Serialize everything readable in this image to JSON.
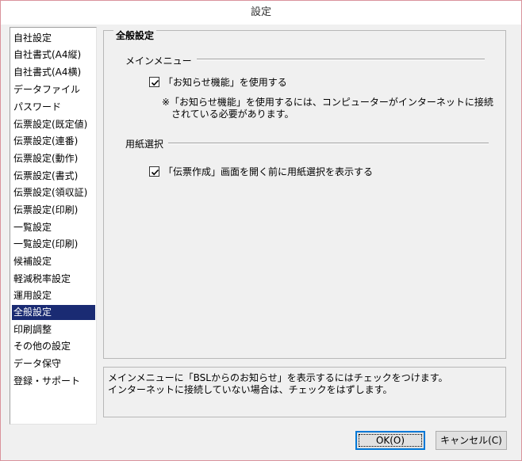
{
  "window": {
    "title": "設定"
  },
  "sidebar": {
    "items": [
      {
        "label": "自社設定"
      },
      {
        "label": "自社書式(A4縦)"
      },
      {
        "label": "自社書式(A4横)"
      },
      {
        "label": "データファイル"
      },
      {
        "label": "パスワード"
      },
      {
        "label": "伝票設定(既定値)"
      },
      {
        "label": "伝票設定(連番)"
      },
      {
        "label": "伝票設定(動作)"
      },
      {
        "label": "伝票設定(書式)"
      },
      {
        "label": "伝票設定(領収証)"
      },
      {
        "label": "伝票設定(印刷)"
      },
      {
        "label": "一覧設定"
      },
      {
        "label": "一覧設定(印刷)"
      },
      {
        "label": "候補設定"
      },
      {
        "label": "軽減税率設定"
      },
      {
        "label": "運用設定"
      },
      {
        "label": "全般設定"
      },
      {
        "label": "印刷調整"
      },
      {
        "label": "その他の設定"
      },
      {
        "label": "データ保守"
      },
      {
        "label": "登録・サポート"
      }
    ],
    "selected": "全般設定"
  },
  "main": {
    "title": "全般設定",
    "sections": [
      {
        "label": "メインメニュー",
        "checkbox": {
          "label": "「お知らせ機能」を使用する",
          "checked": true
        },
        "note_line1": "※「お知らせ機能」を使用するには、コンピューターがインターネットに接続",
        "note_line2": "されている必要があります。"
      },
      {
        "label": "用紙選択",
        "checkbox": {
          "label": "「伝票作成」画面を開く前に用紙選択を表示する",
          "checked": true
        }
      }
    ]
  },
  "help": {
    "line1": "メインメニューに「BSLからのお知らせ」を表示するにはチェックをつけます。",
    "line2": "インターネットに接続していない場合は、チェックをはずします。"
  },
  "buttons": {
    "ok": "OK(O)",
    "cancel": "キャンセル(C)"
  },
  "colors": {
    "selection": "#1a2b73",
    "default_button_border": "#0078d7",
    "window_border": "#d9939c"
  }
}
